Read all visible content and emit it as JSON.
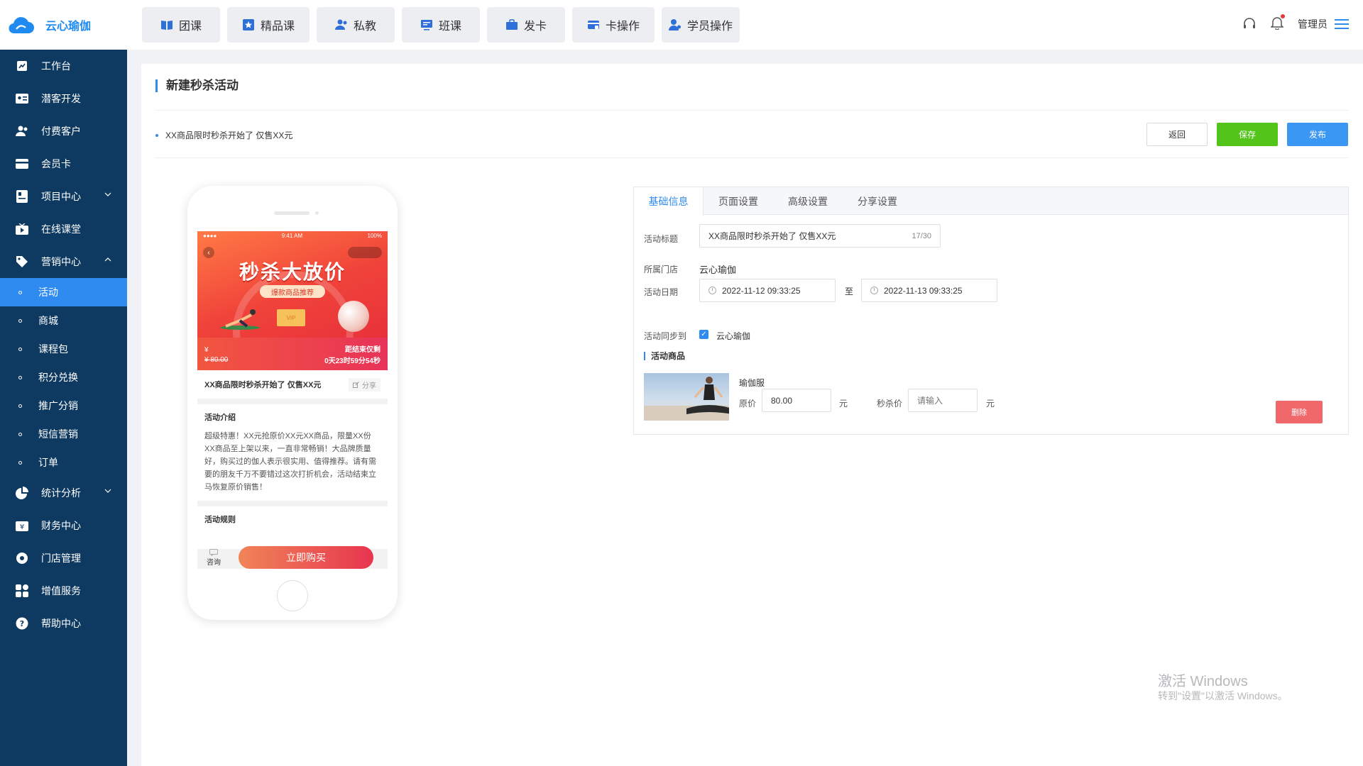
{
  "brand": {
    "name": "云心瑜伽",
    "color": "#1f8bf0"
  },
  "colors": {
    "sidebar_bg": "#0e3a62",
    "accent": "#2f8bf0",
    "save": "#52c41a",
    "delete": "#f0686a"
  },
  "sidebar": {
    "items": [
      {
        "label": "工作台",
        "icon": "dashboard-icon"
      },
      {
        "label": "潜客开发",
        "icon": "prospect-card-icon"
      },
      {
        "label": "付费客户",
        "icon": "customers-icon"
      },
      {
        "label": "会员卡",
        "icon": "member-card-icon"
      },
      {
        "label": "项目中心",
        "icon": "project-icon",
        "expandable": true
      },
      {
        "label": "在线课堂",
        "icon": "video-class-icon"
      },
      {
        "label": "营销中心",
        "icon": "marketing-tag-icon",
        "expanded": true
      }
    ],
    "sub_items": [
      "活动",
      "商城",
      "课程包",
      "积分兑换",
      "推广分销",
      "短信营销",
      "订单"
    ],
    "active_sub": "活动",
    "items_after": [
      {
        "label": "统计分析",
        "icon": "pie-chart-icon",
        "expandable": true
      },
      {
        "label": "财务中心",
        "icon": "finance-icon"
      },
      {
        "label": "门店管理",
        "icon": "store-icon"
      },
      {
        "label": "增值服务",
        "icon": "apps-icon"
      },
      {
        "label": "帮助中心",
        "icon": "help-icon"
      }
    ]
  },
  "topnav": [
    "团课",
    "精品课",
    "私教",
    "班课",
    "发卡",
    "卡操作",
    "学员操作"
  ],
  "header_user": "管理员",
  "page": {
    "title": "新建秒杀活动",
    "notice": "XX商品限时秒杀开始了 仅售XX元",
    "buttons": {
      "back": "返回",
      "save": "保存",
      "publish": "发布"
    }
  },
  "phone": {
    "status_time": "9:41 AM",
    "status_battery": "100%",
    "banner_title": "秒杀大放价",
    "banner_sub": "爆款商品推荐",
    "vip_label": "VIP",
    "currency": "¥",
    "original_price": "80.00",
    "countdown_label": "距结束仅剩",
    "countdown": "0天23时59分54秒",
    "product_title": "XX商品限时秒杀开始了 仅售XX元",
    "share": "分享",
    "intro_title": "活动介绍",
    "intro_text": "超级特惠！XX元抢原价XX元XX商品，限量XX份 XX商品至上架以来，一直非常畅销！大品牌质量好，购买过的伽人表示很实用、值得推荐。请有需要的朋友千万不要错过这次打折机会，活动结束立马恢复原价销售！",
    "rules_title": "活动规则",
    "consult": "咨询",
    "buy": "立即购买"
  },
  "form": {
    "tabs": [
      "基础信息",
      "页面设置",
      "高级设置",
      "分享设置"
    ],
    "active_tab": "基础信息",
    "title_label": "活动标题",
    "title_value": "XX商品限时秒杀开始了 仅售XX元",
    "title_count": "17/30",
    "store_label": "所属门店",
    "store_value": "云心瑜伽",
    "date_label": "活动日期",
    "date_start": "2022-11-12 09:33:25",
    "date_sep": "至",
    "date_end": "2022-11-13 09:33:25",
    "sync_label": "活动同步到",
    "sync_option": "云心瑜伽",
    "goods_title": "活动商品",
    "goods_name": "瑜伽服",
    "price_label": "原价",
    "price_value": "80.00",
    "yuan": "元",
    "seckill_label": "秒杀价",
    "seckill_placeholder": "请输入",
    "delete": "删除"
  },
  "watermark": {
    "line1": "激活 Windows",
    "line2": "转到\"设置\"以激活 Windows。"
  }
}
